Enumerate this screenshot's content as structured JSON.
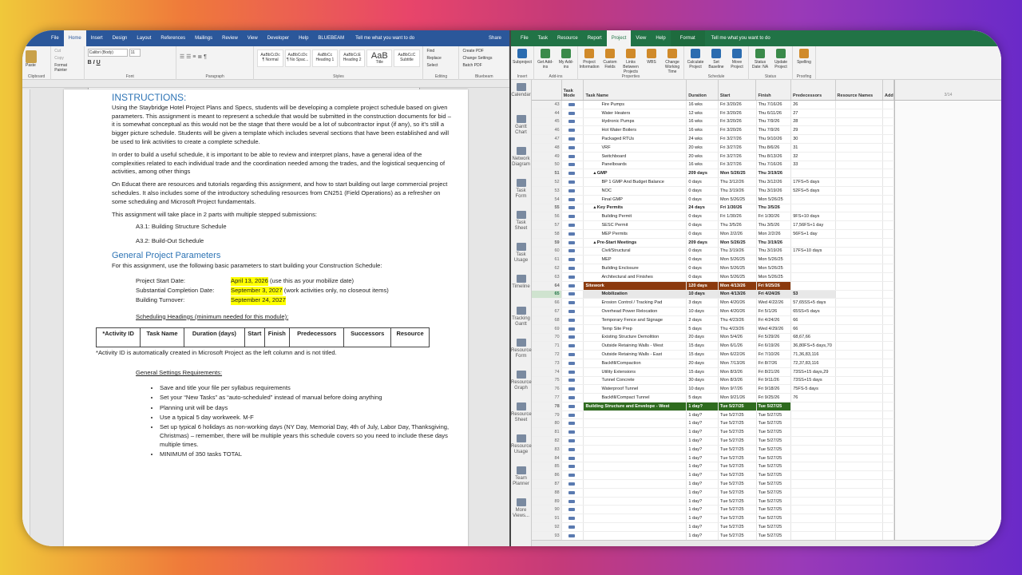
{
  "word": {
    "tabs": [
      "File",
      "Home",
      "Insert",
      "Design",
      "Layout",
      "References",
      "Mailings",
      "Review",
      "View",
      "Developer",
      "Help",
      "BLUEBEAM"
    ],
    "active_tab": "Home",
    "tell_me": "Tell me what you want to do",
    "share": "Share",
    "font_name": "Calibri (Body)",
    "font_size": "11",
    "clipboard_items": [
      "Cut",
      "Copy",
      "Format Painter"
    ],
    "paste": "Paste",
    "groups": [
      "Clipboard",
      "Font",
      "Paragraph",
      "Styles",
      "Editing",
      "Bluebeam"
    ],
    "styles": [
      {
        "sample": "AaBbCcDc",
        "name": "¶ Normal"
      },
      {
        "sample": "AaBbCcDc",
        "name": "¶ No Spac..."
      },
      {
        "sample": "AaBbCc",
        "name": "Heading 1"
      },
      {
        "sample": "AaBbCcE",
        "name": "Heading 2"
      },
      {
        "sample": "AaB",
        "name": "Title"
      },
      {
        "sample": "AaBbCcC",
        "name": "Subtitle"
      }
    ],
    "editing": [
      "Find",
      "Replace",
      "Select"
    ],
    "bluebeam": [
      "Create PDF",
      "Change Settings",
      "Batch PDF"
    ],
    "doc": {
      "instructions_title": "INSTRUCTIONS:",
      "p1": "Using the Staybridge Hotel Project Plans and Specs, students will be developing a complete project schedule based on given parameters.  This assignment is meant to represent a schedule that would be submitted in the construction documents for bid – it is somewhat conceptual as this would not be the stage that there would be a lot of subcontractor input (if any), so it’s still a bigger picture schedule.  Students will be given a template which includes several sections that have been established and will be used to link activities to create a complete schedule.",
      "p2": "In order to build a useful schedule, it is important to be able to review and interpret plans, have a general idea of the complexities related to each individual trade and the coordination needed among the trades, and the logistical sequencing of activities, among other things",
      "p3": "On Educat there are resources and tutorials regarding this assignment, and how to start building out large commercial project schedules.  It also includes some of the introductory scheduling resources from CN251 (Field Operations) as a refresher on some scheduling and Microsoft Project fundamentals.",
      "p4": "This assignment will take place in 2 parts with multiple stepped submissions:",
      "a31": "A3.1: Building Structure Schedule",
      "a32": "A3.2: Build-Out Schedule",
      "gpp_title": "General Project Parameters",
      "gpp_intro": "For this assignment, use the following basic parameters to start building your Construction Schedule:",
      "params": [
        {
          "label": "Project Start Date:",
          "value": "April 13, 2026",
          "note": " (use this as your mobilize date)"
        },
        {
          "label": "Substantial Completion Date:",
          "value": "September 3, 2027",
          "note": " (work activities only, no closeout items)"
        },
        {
          "label": "Building Turnover:",
          "value": "September 24, 2027",
          "note": ""
        }
      ],
      "sched_heading": "Scheduling Headings (minimum needed for this module):",
      "table_headers": [
        "*Activity ID",
        "Task Name",
        "Duration (days)",
        "Start",
        "Finish",
        "Predecessors",
        "Successors",
        "Resource"
      ],
      "table_note": "*Activity ID is automatically created in Microsoft Project as the left column and is not titled.",
      "gen_settings": "General Settings Requirements:",
      "bullets": [
        "Save and title your file per syllabus requirements",
        "Set your “New Tasks” as “auto-scheduled” instead of manual before doing anything",
        "Planning unit will be days",
        "Use a typical 5 day workweek. M-F",
        "Set up typical 6 holidays as non-working days (NY Day, Memorial Day, 4th of July, Labor Day, Thanksgiving, Christmas) – remember, there will be multiple years this schedule covers so you need to include these days multiple times.",
        "MINIMUM of 350 tasks TOTAL"
      ]
    }
  },
  "project": {
    "tabs": [
      "File",
      "Task",
      "Resource",
      "Report",
      "Project",
      "View",
      "Help",
      "Format"
    ],
    "active_tab": "Project",
    "tell_me": "Tell me what you want to do",
    "ribbon": [
      {
        "group": "Insert",
        "buttons": [
          "Subproject"
        ]
      },
      {
        "group": "Add-ins",
        "buttons": [
          "Get Add-ins",
          "My Add-ins"
        ]
      },
      {
        "group": "Properties",
        "buttons": [
          "Project Information",
          "Custom Fields",
          "Links Between Projects",
          "WBS",
          "Change Working Time"
        ]
      },
      {
        "group": "Schedule",
        "buttons": [
          "Calculate Project",
          "Set Baseline",
          "Move Project"
        ]
      },
      {
        "group": "Status",
        "buttons": [
          "Status Date: NA",
          "Update Project"
        ]
      },
      {
        "group": "Proofing",
        "buttons": [
          "Spelling"
        ]
      }
    ],
    "views": [
      "Calendar",
      "Gantt Chart",
      "Network Diagram",
      "Task Form",
      "Task Sheet",
      "Task Usage",
      "Timeline",
      "Tracking Gantt",
      "Resource Form",
      "Resource Graph",
      "Resource Sheet",
      "Resource Usage",
      "Team Planner",
      "More Views..."
    ],
    "columns": [
      "",
      "Task Mode",
      "Task Name",
      "Duration",
      "Start",
      "Finish",
      "Predecessors",
      "Resource Names",
      "Add"
    ],
    "timeline_label": "3/14",
    "rows": [
      [
        "43",
        "Fire Pumps",
        "16 wks",
        "Fri 3/20/26",
        "Thu 7/16/26",
        "26",
        "n"
      ],
      [
        "44",
        "Water Heaters",
        "12 wks",
        "Fri 3/20/26",
        "Thu 6/11/26",
        "27",
        "n"
      ],
      [
        "45",
        "Hydronic Pumps",
        "16 wks",
        "Fri 3/20/26",
        "Thu 7/9/26",
        "28",
        "n"
      ],
      [
        "46",
        "Hot Water Boilers",
        "16 wks",
        "Fri 3/20/26",
        "Thu 7/9/26",
        "29",
        "n"
      ],
      [
        "47",
        "Packaged RTUs",
        "24 wks",
        "Fri 3/27/26",
        "Thu 9/10/26",
        "30",
        "n"
      ],
      [
        "48",
        "VRF",
        "20 wks",
        "Fri 3/27/26",
        "Thu 8/6/26",
        "31",
        "n"
      ],
      [
        "49",
        "Switchboard",
        "20 wks",
        "Fri 3/27/26",
        "Thu 8/13/26",
        "32",
        "n"
      ],
      [
        "50",
        "Panelboards",
        "16 wks",
        "Fri 3/27/26",
        "Thu 7/16/26",
        "33",
        "n"
      ],
      [
        "51",
        "▴ GMP",
        "209 days",
        "Mon 5/26/25",
        "Thu 3/19/26",
        "",
        "s"
      ],
      [
        "52",
        "BP 1 GMP And Budget Balance",
        "0 days",
        "Thu 3/12/26",
        "Thu 3/12/26",
        "17FS+5 days",
        "n"
      ],
      [
        "53",
        "NOC",
        "0 days",
        "Thu 3/19/26",
        "Thu 3/19/26",
        "52FS+5 days",
        "n"
      ],
      [
        "54",
        "Final GMP",
        "0 days",
        "Mon 5/26/25",
        "Mon 5/26/25",
        "",
        "n"
      ],
      [
        "55",
        "▴ Key Permits",
        "24 days",
        "Fri 1/30/26",
        "Thu 3/5/26",
        "",
        "s"
      ],
      [
        "56",
        "Building Permit",
        "0 days",
        "Fri 1/30/26",
        "Fri 1/30/26",
        "9FS+10 days",
        "n"
      ],
      [
        "57",
        "SESC Permit",
        "0 days",
        "Thu 3/5/26",
        "Thu 3/5/26",
        "17,56FS+1 day",
        "n"
      ],
      [
        "58",
        "MEP Permits",
        "0 days",
        "Mon 2/2/26",
        "Mon 2/2/26",
        "56FS+1 day",
        "n"
      ],
      [
        "59",
        "▴ Pre-Start Meetings",
        "209 days",
        "Mon 5/26/25",
        "Thu 3/19/26",
        "",
        "s"
      ],
      [
        "60",
        "Civil/Structural",
        "0 days",
        "Thu 3/19/26",
        "Thu 3/19/26",
        "17FS+10 days",
        "n"
      ],
      [
        "61",
        "MEP",
        "0 days",
        "Mon 5/26/25",
        "Mon 5/26/25",
        "",
        "n"
      ],
      [
        "62",
        "Building Enclosure",
        "0 days",
        "Mon 5/26/25",
        "Mon 5/26/25",
        "",
        "n"
      ],
      [
        "63",
        "Architectural and Finishes",
        "0 days",
        "Mon 5/26/25",
        "Mon 5/26/25",
        "",
        "n"
      ],
      [
        "64",
        "Sitework",
        "120 days",
        "Mon 4/13/26",
        "Fri 9/25/26",
        "",
        "sw"
      ],
      [
        "65",
        "Mobilization",
        "10 days",
        "Mon 4/13/26",
        "Fri 4/24/26",
        "53",
        "sel"
      ],
      [
        "66",
        "Erosion Control / Tracking Pad",
        "3 days",
        "Mon 4/20/26",
        "Wed 4/22/26",
        "57,65SS+5 days",
        "n"
      ],
      [
        "67",
        "Overhead Power Relocation",
        "10 days",
        "Mon 4/20/26",
        "Fri 5/1/26",
        "65SS+5 days",
        "n"
      ],
      [
        "68",
        "Temporary Fence and Signage",
        "2 days",
        "Thu 4/23/26",
        "Fri 4/24/26",
        "66",
        "n"
      ],
      [
        "69",
        "Temp Site Prep",
        "5 days",
        "Thu 4/23/26",
        "Wed 4/29/26",
        "66",
        "n"
      ],
      [
        "70",
        "Existing Structure Demolition",
        "20 days",
        "Mon 5/4/26",
        "Fri 5/29/26",
        "68,67,66",
        "n"
      ],
      [
        "71",
        "Outside Retaining Walls - West",
        "15 days",
        "Mon 6/1/26",
        "Fri 6/19/26",
        "36,80FS+5 days,70",
        "n"
      ],
      [
        "72",
        "Outside Retaining Walls - East",
        "15 days",
        "Mon 6/22/26",
        "Fri 7/10/26",
        "71,36,83,116",
        "n"
      ],
      [
        "73",
        "Backfill/Compaction",
        "20 days",
        "Mon 7/13/26",
        "Fri 8/7/26",
        "72,37,83,116",
        "n"
      ],
      [
        "74",
        "Utility Extensions",
        "15 days",
        "Mon 8/3/26",
        "Fri 8/21/26",
        "73SS+15 days,29",
        "n"
      ],
      [
        "75",
        "Tunnel Concrete",
        "30 days",
        "Mon 8/3/26",
        "Fri 9/11/26",
        "73SS+15 days",
        "n"
      ],
      [
        "76",
        "Waterproof Tunnel",
        "10 days",
        "Mon 9/7/26",
        "Fri 9/18/26",
        "75FS-5 days",
        "n"
      ],
      [
        "77",
        "Backfill/Compact Tunnel",
        "5 days",
        "Mon 9/21/26",
        "Fri 9/25/26",
        "76",
        "n"
      ],
      [
        "78",
        "Building Structure and Envelope - West",
        "1 day?",
        "Tue 5/27/25",
        "Tue 5/27/25",
        "",
        "bs"
      ],
      [
        "79",
        "",
        "1 day?",
        "Tue 5/27/25",
        "Tue 5/27/25",
        "",
        "n"
      ],
      [
        "80",
        "",
        "1 day?",
        "Tue 5/27/25",
        "Tue 5/27/25",
        "",
        "n"
      ],
      [
        "81",
        "",
        "1 day?",
        "Tue 5/27/25",
        "Tue 5/27/25",
        "",
        "n"
      ],
      [
        "82",
        "",
        "1 day?",
        "Tue 5/27/25",
        "Tue 5/27/25",
        "",
        "n"
      ],
      [
        "83",
        "",
        "1 day?",
        "Tue 5/27/25",
        "Tue 5/27/25",
        "",
        "n"
      ],
      [
        "84",
        "",
        "1 day?",
        "Tue 5/27/25",
        "Tue 5/27/25",
        "",
        "n"
      ],
      [
        "85",
        "",
        "1 day?",
        "Tue 5/27/25",
        "Tue 5/27/25",
        "",
        "n"
      ],
      [
        "86",
        "",
        "1 day?",
        "Tue 5/27/25",
        "Tue 5/27/25",
        "",
        "n"
      ],
      [
        "87",
        "",
        "1 day?",
        "Tue 5/27/25",
        "Tue 5/27/25",
        "",
        "n"
      ],
      [
        "88",
        "",
        "1 day?",
        "Tue 5/27/25",
        "Tue 5/27/25",
        "",
        "n"
      ],
      [
        "89",
        "",
        "1 day?",
        "Tue 5/27/25",
        "Tue 5/27/25",
        "",
        "n"
      ],
      [
        "90",
        "",
        "1 day?",
        "Tue 5/27/25",
        "Tue 5/27/25",
        "",
        "n"
      ],
      [
        "91",
        "",
        "1 day?",
        "Tue 5/27/25",
        "Tue 5/27/25",
        "",
        "n"
      ],
      [
        "92",
        "",
        "1 day?",
        "Tue 5/27/25",
        "Tue 5/27/25",
        "",
        "n"
      ],
      [
        "93",
        "",
        "1 day?",
        "Tue 5/27/25",
        "Tue 5/27/25",
        "",
        "n"
      ]
    ]
  }
}
